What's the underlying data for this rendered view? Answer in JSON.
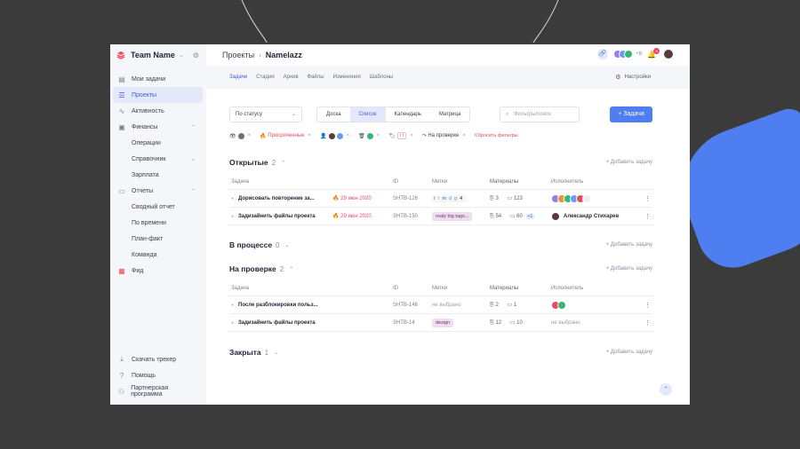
{
  "colors": {
    "accent": "#4f7ef0",
    "danger": "#e84a5f",
    "background": "#3b3b3b"
  },
  "team": {
    "name": "Team Name"
  },
  "sidebar": {
    "items": [
      {
        "label": "Мои задачи",
        "icon": "clipboard-icon"
      },
      {
        "label": "Проекты",
        "icon": "list-icon",
        "active": true
      },
      {
        "label": "Активность",
        "icon": "pulse-icon"
      },
      {
        "label": "Финансы",
        "icon": "briefcase-icon"
      },
      {
        "label": "Операции",
        "sub": true
      },
      {
        "label": "Справочник",
        "sub": true
      },
      {
        "label": "Зарплата",
        "sub": true
      },
      {
        "label": "Отчеты",
        "icon": "document-icon"
      },
      {
        "label": "Сводный отчет",
        "sub": true
      },
      {
        "label": "По времени",
        "sub": true
      },
      {
        "label": "План-факт",
        "sub": true
      },
      {
        "label": "Команда",
        "sub": true
      },
      {
        "label": "Фид",
        "icon": "feed-icon"
      }
    ],
    "bottom": [
      {
        "label": "Скачать трекер",
        "icon": "download-icon"
      },
      {
        "label": "Помощь",
        "icon": "help-icon"
      },
      {
        "label": "Партнерская программа",
        "icon": "partners-icon"
      }
    ]
  },
  "breadcrumb": {
    "root": "Проекты",
    "current": "Namelazz"
  },
  "header": {
    "extra_members": "+8",
    "notifications": "3"
  },
  "tabs": [
    "Задачи",
    "Стадии",
    "Архив",
    "Файлы",
    "Изменения",
    "Шаблоны"
  ],
  "settings_label": "Настройки",
  "toolbar": {
    "status_select": "По статусу",
    "views": [
      "Доска",
      "Список",
      "Календарь",
      "Матрица"
    ],
    "search_placeholder": "Фильтры/поиск",
    "add_task": "+ Задача"
  },
  "filters": {
    "overdue": "Просроченные",
    "tags": "t",
    "review": "На проверке",
    "reset": "Сбросить фильтры"
  },
  "columns": {
    "task": "Задача",
    "id": "ID",
    "tags": "Метки",
    "materials": "Материалы",
    "assignee": "Исполнитель"
  },
  "add_task_label": "+ Добавить задачу",
  "sections": {
    "open": {
      "title": "Открытые",
      "count": "2",
      "rows": [
        {
          "name": "Дорисовать повторение за...",
          "date": "29 июн 2020",
          "id": "SHTB-126",
          "tags": [
            "t",
            "r",
            "m",
            "d",
            "g"
          ],
          "tags_more": "4",
          "files": "3",
          "comments": "123"
        },
        {
          "name": "Задизайнить файлы проекта",
          "date": "29 июн 2020",
          "id": "SHTB-150",
          "tag_pill": "realy big tags...",
          "files": "54",
          "comments": "60",
          "comments_new": "+1",
          "assignee": "Александр Стихарев"
        }
      ]
    },
    "inprogress": {
      "title": "В процессе",
      "count": "0"
    },
    "review": {
      "title": "На проверке",
      "count": "2",
      "rows": [
        {
          "name": "После разблокировки польз...",
          "id": "SHTB-146",
          "tags_none": "не выбрано",
          "files": "2",
          "comments": "1"
        },
        {
          "name": "Задизайнить файлы проекта",
          "id": "SHTB-14",
          "tag_pill": "design",
          "files": "12",
          "comments": "10",
          "assignee_none": "не выбрано"
        }
      ]
    },
    "closed": {
      "title": "Закрыта",
      "count": "1"
    }
  }
}
